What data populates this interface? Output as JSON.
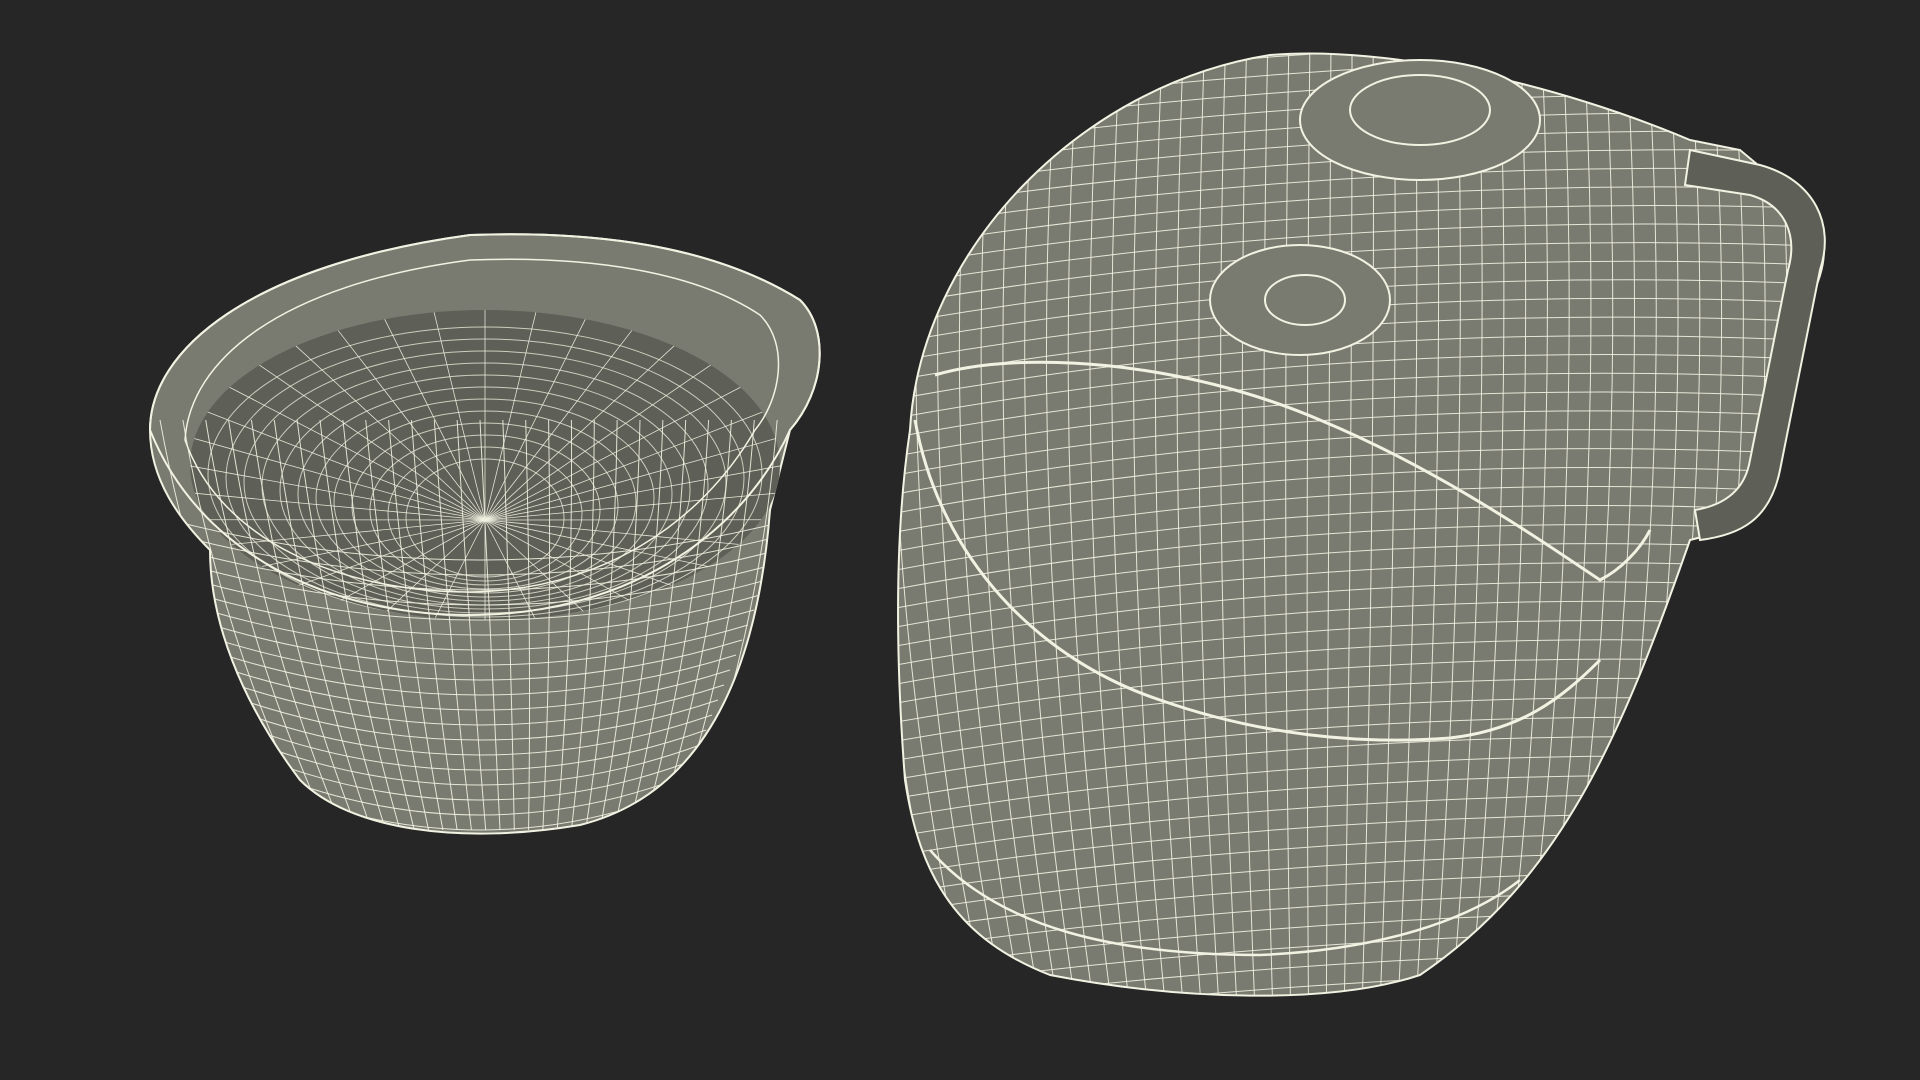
{
  "scene": {
    "background_color": "#262626",
    "mesh_fill_color": "#7a7b70",
    "mesh_fill_dark_color": "#5e5f56",
    "wire_color": "#f2f2e2",
    "objects": [
      {
        "name": "inner-pot",
        "kind": "wireframe-mesh"
      },
      {
        "name": "rice-cooker-body",
        "kind": "wireframe-mesh"
      }
    ]
  }
}
